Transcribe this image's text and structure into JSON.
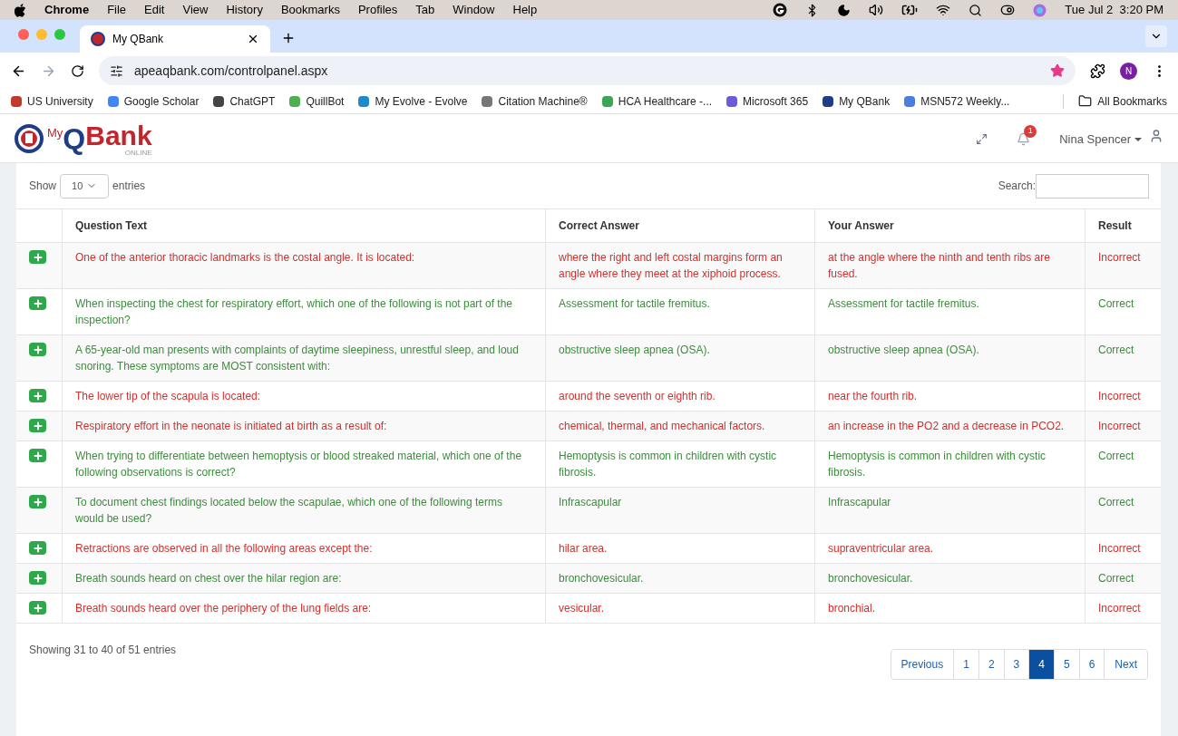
{
  "menu_bar": {
    "app": "Chrome",
    "items": [
      "File",
      "Edit",
      "View",
      "History",
      "Bookmarks",
      "Profiles",
      "Tab",
      "Window",
      "Help"
    ],
    "clock": "Tue Jul 2  3:20 PM"
  },
  "browser": {
    "tab_title": "My QBank",
    "url": "apeaqbank.com/controlpanel.aspx",
    "profile_initial": "N",
    "bookmarks": [
      {
        "label": "US University",
        "color": "#c0392b"
      },
      {
        "label": "Google Scholar",
        "color": "#4285f4"
      },
      {
        "label": "ChatGPT",
        "color": "#444444"
      },
      {
        "label": "QuillBot",
        "color": "#4caf50"
      },
      {
        "label": "My Evolve - Evolve",
        "color": "#1e88c8"
      },
      {
        "label": "Citation Machine®",
        "color": "#777777"
      },
      {
        "label": "HCA Healthcare -...",
        "color": "#3aa655"
      },
      {
        "label": "Microsoft 365",
        "color": "#6b5bd6"
      },
      {
        "label": "My QBank",
        "color": "#1f3c88"
      },
      {
        "label": "MSN572 Weekly...",
        "color": "#4a7fe0"
      }
    ],
    "all_bookmarks": "All Bookmarks"
  },
  "header": {
    "logo": {
      "prefix": "My",
      "q": "Q",
      "bank": "Bank",
      "tagline": "ONLINE"
    },
    "notification_count": "1",
    "user": "Nina Spencer"
  },
  "table_controls": {
    "show": "Show",
    "page_size": "10",
    "entries": "entries",
    "search_label": "Search:"
  },
  "table": {
    "columns": [
      "Question Text",
      "Correct Answer",
      "Your Answer",
      "Result"
    ],
    "rows": [
      {
        "kind": "incorrect",
        "question": "One of the anterior thoracic landmarks is the costal angle. It is located:",
        "correct_answer": "where the right and left costal margins form an angle where they meet at the xiphoid process.",
        "your_answer": "at the angle where the ninth and tenth ribs are fused.",
        "result": "Incorrect"
      },
      {
        "kind": "correct",
        "question": "When inspecting the chest for respiratory effort, which one of the following is not part of the inspection?",
        "correct_answer": "Assessment for tactile fremitus.",
        "your_answer": "Assessment for tactile fremitus.",
        "result": "Correct"
      },
      {
        "kind": "correct",
        "question": "A 65-year-old man presents with complaints of daytime sleepiness, unrestful sleep, and loud snoring. These symptoms are MOST consistent with:",
        "correct_answer": "obstructive sleep apnea (OSA).",
        "your_answer": "obstructive sleep apnea (OSA).",
        "result": "Correct"
      },
      {
        "kind": "incorrect",
        "question": "The lower tip of the scapula is located:",
        "correct_answer": "around the seventh or eighth rib.",
        "your_answer": "near the fourth rib.",
        "result": "Incorrect"
      },
      {
        "kind": "incorrect",
        "question": "Respiratory effort in the neonate is initiated at birth as a result of:",
        "correct_answer": "chemical, thermal, and mechanical factors.",
        "your_answer": "an increase in the PO2 and a decrease in PCO2.",
        "result": "Incorrect"
      },
      {
        "kind": "correct",
        "question": "When trying to differentiate between hemoptysis or blood streaked material, which one of the following observations is correct?",
        "correct_answer": "Hemoptysis is common in children with cystic fibrosis.",
        "your_answer": "Hemoptysis is common in children with cystic fibrosis.",
        "result": "Correct"
      },
      {
        "kind": "correct",
        "question": "To document chest findings located below the scapulae, which one of the following terms would be used?",
        "correct_answer": "Infrascapular",
        "your_answer": "Infrascapular",
        "result": "Correct"
      },
      {
        "kind": "incorrect",
        "question": "Retractions are observed in all the following areas except the:",
        "correct_answer": "hilar area.",
        "your_answer": "supraventricular area.",
        "result": "Incorrect"
      },
      {
        "kind": "correct",
        "question": "Breath sounds heard on chest over the hilar region are:",
        "correct_answer": "bronchovesicular.",
        "your_answer": "bronchovesicular.",
        "result": "Correct"
      },
      {
        "kind": "incorrect",
        "question": "Breath sounds heard over the periphery of the lung fields are:",
        "correct_answer": "vesicular.",
        "your_answer": "bronchial.",
        "result": "Incorrect"
      }
    ]
  },
  "table_info": "Showing 31 to 40 of 51 entries",
  "pagination": {
    "previous": "Previous",
    "next": "Next",
    "pages": [
      {
        "label": "1",
        "selected": false
      },
      {
        "label": "2",
        "selected": false
      },
      {
        "label": "3",
        "selected": false
      },
      {
        "label": "4",
        "selected": true
      },
      {
        "label": "5",
        "selected": false
      },
      {
        "label": "6",
        "selected": false
      }
    ]
  }
}
